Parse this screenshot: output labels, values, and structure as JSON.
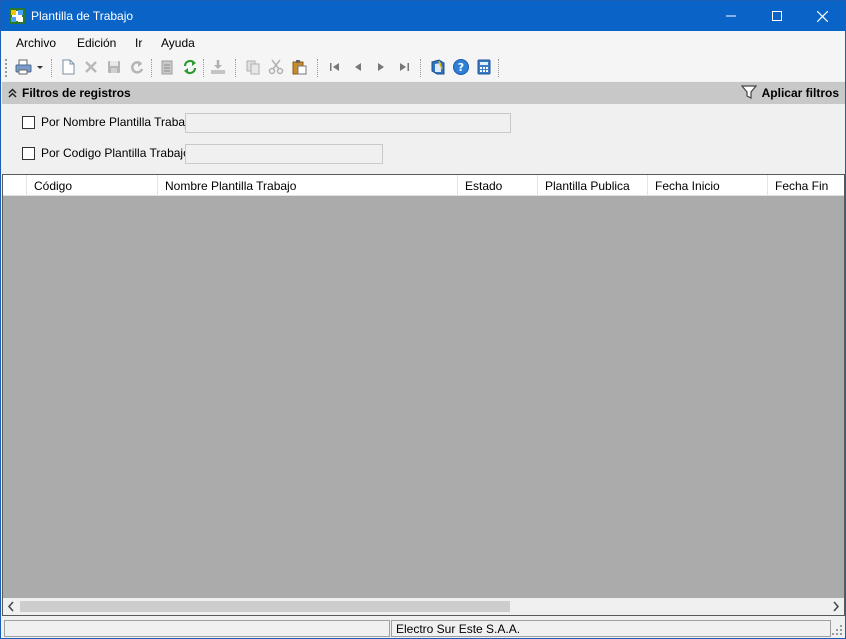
{
  "window": {
    "title": "Plantilla de Trabajo"
  },
  "menu": {
    "items": [
      "Archivo",
      "Edición",
      "Ir",
      "Ayuda"
    ]
  },
  "toolbar": {
    "icons": [
      "print-icon",
      "new-document-icon",
      "delete-icon",
      "save-icon",
      "undo-icon",
      "notes-icon",
      "refresh-icon",
      "export-icon",
      "copy-icon",
      "cut-icon",
      "paste-icon",
      "first-record-icon",
      "previous-record-icon",
      "next-record-icon",
      "last-record-icon",
      "manual-icon",
      "help-icon",
      "calculator-icon"
    ]
  },
  "filters": {
    "title": "Filtros de registros",
    "apply_label": "Aplicar filtros",
    "by_name_label": "Por Nombre Plantilla Trabajo:",
    "by_code_label": "Por Codigo Plantilla Trabajo:",
    "by_name_value": "",
    "by_code_value": ""
  },
  "grid": {
    "columns": [
      "Código",
      "Nombre Plantilla Trabajo",
      "Estado",
      "Plantilla Publica",
      "Fecha Inicio",
      "Fecha Fin"
    ]
  },
  "status": {
    "left": "",
    "company": "Electro Sur Este S.A.A."
  },
  "colors": {
    "titlebar": "#0a64c8",
    "grid_background": "#ababab",
    "filter_header": "#c8c8c8"
  }
}
